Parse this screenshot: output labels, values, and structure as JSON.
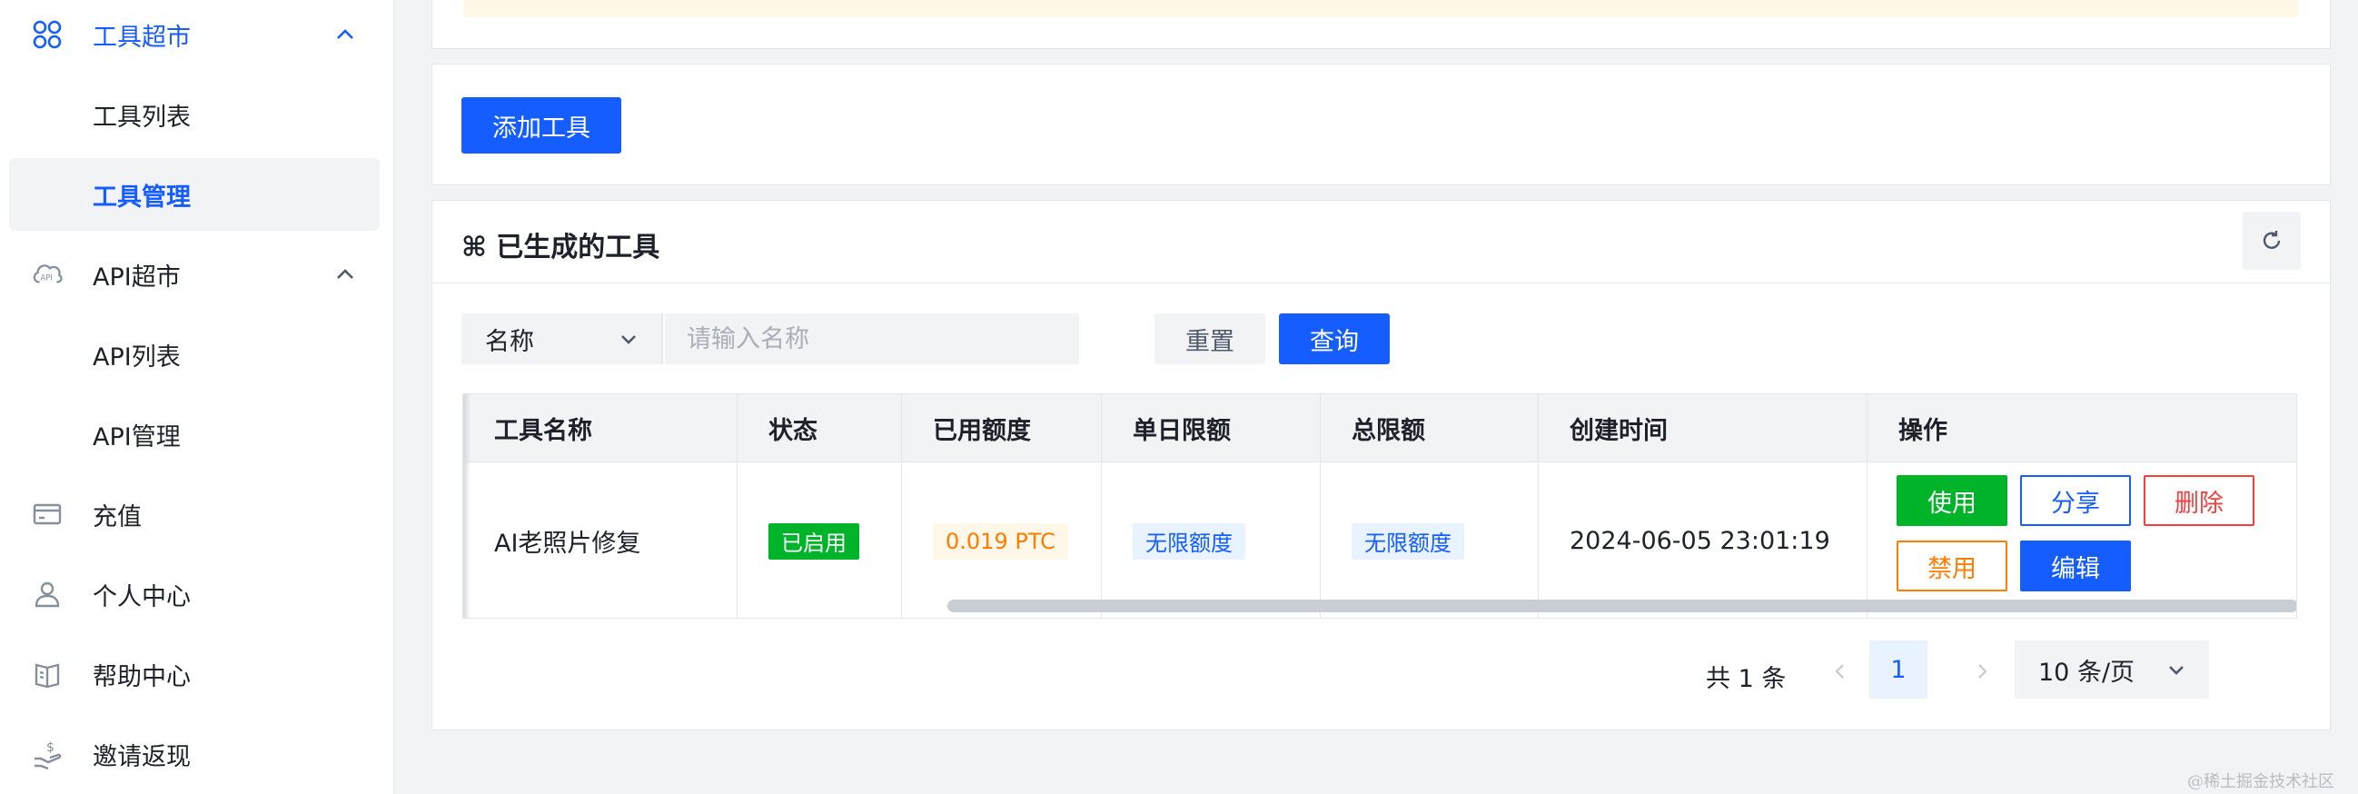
{
  "sidebar": {
    "items": [
      {
        "label": "工具超市",
        "icon": "apps-icon",
        "expanded": true
      },
      {
        "label": "工具列表"
      },
      {
        "label": "工具管理",
        "selected": true
      },
      {
        "label": "API超市",
        "icon": "api-cloud-icon",
        "expanded": true
      },
      {
        "label": "API列表"
      },
      {
        "label": "API管理"
      },
      {
        "label": "充值",
        "icon": "card-icon"
      },
      {
        "label": "个人中心",
        "icon": "user-icon"
      },
      {
        "label": "帮助中心",
        "icon": "book-icon"
      },
      {
        "label": "邀请返现",
        "icon": "cashback-icon"
      }
    ]
  },
  "toolbar": {
    "add_label": "添加工具"
  },
  "card": {
    "title": "⌘ 已生成的工具"
  },
  "filter": {
    "field_select": "名称",
    "search_placeholder": "请输入名称",
    "reset_label": "重置",
    "query_label": "查询"
  },
  "table": {
    "headers": [
      "工具名称",
      "状态",
      "已用额度",
      "单日限额",
      "总限额",
      "创建时间",
      "操作"
    ],
    "rows": [
      {
        "name": "AI老照片修复",
        "status": "已启用",
        "used": "0.019 PTC",
        "daily_limit": "无限额度",
        "total_limit": "无限额度",
        "created": "2024-06-05 23:01:19",
        "actions": {
          "use": "使用",
          "share": "分享",
          "delete": "删除",
          "disable": "禁用",
          "edit": "编辑"
        }
      }
    ]
  },
  "pagination": {
    "total_label": "共 1 条",
    "current_page": "1",
    "page_size": "10 条/页"
  },
  "watermark": "@稀土掘金技术社区",
  "colors": {
    "primary": "#165dff",
    "success": "#00b42a",
    "danger": "#f53f3f",
    "warning": "#ff7d00"
  }
}
